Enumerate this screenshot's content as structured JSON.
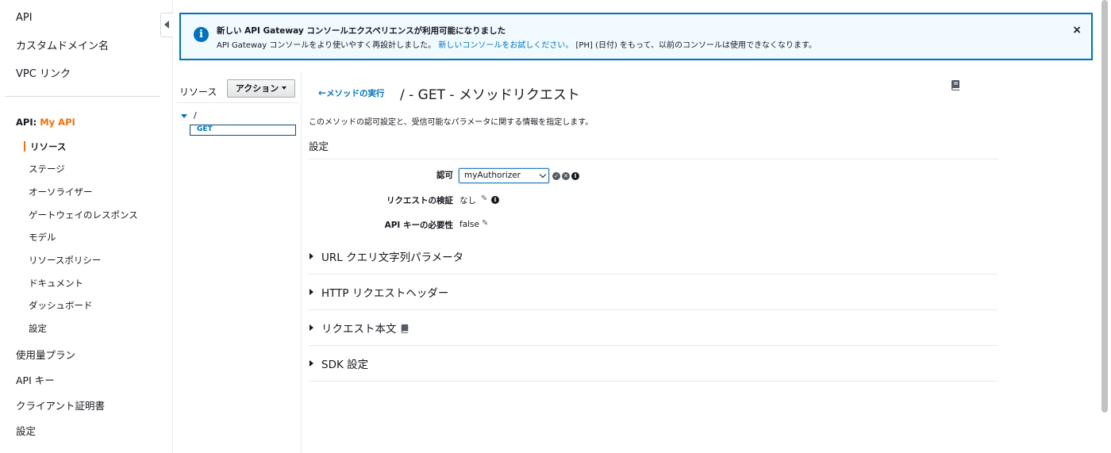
{
  "sidenav": {
    "top_items": [
      "API",
      "カスタムドメイン名",
      "VPC リンク"
    ],
    "api_prefix": "API:",
    "api_name": "My API",
    "sub_items": [
      "リソース",
      "ステージ",
      "オーソライザー",
      "ゲートウェイのレスポンス",
      "モデル",
      "リソースポリシー",
      "ドキュメント",
      "ダッシュボード",
      "設定"
    ],
    "bottom_items": [
      "使用量プラン",
      "API キー",
      "クライアント証明書",
      "設定"
    ]
  },
  "banner": {
    "title": "新しい API Gateway コンソールエクスペリエンスが利用可能になりました",
    "body_before": "API Gateway コンソールをより使いやすく再設計しました。",
    "link": "新しいコンソールをお試しください。",
    "body_after": "[PH] (日付) をもって、以前のコンソールは使用できなくなります。",
    "info_icon": "i",
    "close_icon": "×"
  },
  "resources": {
    "label": "リソース",
    "actions_label": "アクション",
    "root": "/",
    "method": "GET"
  },
  "main": {
    "back_link": "メソッドの実行",
    "title": "/ - GET - メソッドリクエスト",
    "description": "このメソッドの認可設定と、受信可能なパラメータに関する情報を指定します。",
    "settings_title": "設定",
    "auth_label": "認可",
    "auth_value": "myAuthorizer",
    "validation_label": "リクエストの検証",
    "validation_value": "なし",
    "apikey_label": "API キーの必要性",
    "apikey_value": "false",
    "sections": [
      "URL クエリ文字列パラメータ",
      "HTTP リクエストヘッダー",
      "リクエスト本文",
      "SDK 設定"
    ]
  }
}
